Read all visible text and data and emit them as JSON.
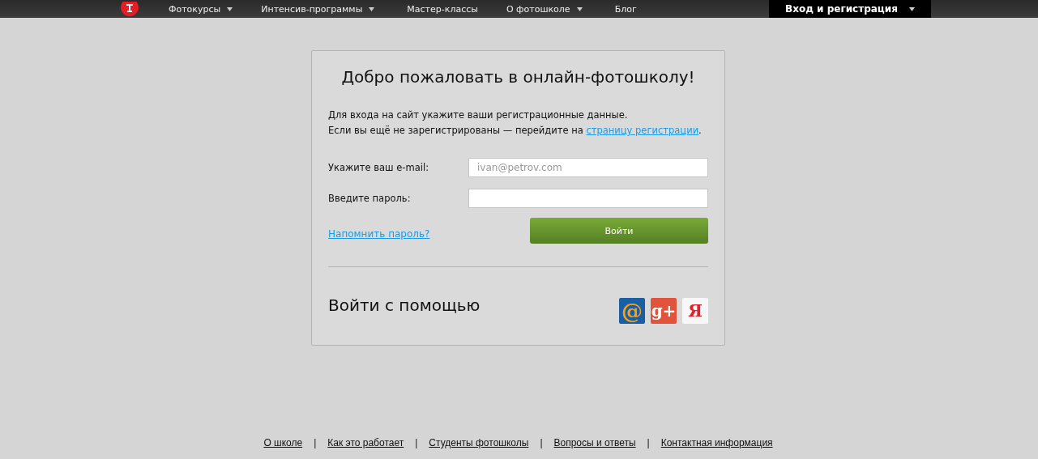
{
  "nav": {
    "items": [
      {
        "label": "Фотокурсы",
        "dropdown": true
      },
      {
        "label": "Интенсив-программы",
        "dropdown": true
      },
      {
        "label": "Мастер-классы",
        "dropdown": false
      },
      {
        "label": "О фотошколе",
        "dropdown": true
      },
      {
        "label": "Блог",
        "dropdown": false
      }
    ],
    "login": {
      "label": "Вход и регистрация",
      "dropdown": true
    }
  },
  "card": {
    "title": "Добро пожаловать в онлайн-фотошколу!",
    "intro_line_1": "Для входа на сайт укажите ваши регистрационные данные.",
    "intro_line_2": "Если вы ещё не зарегистрированы — перейдите на",
    "register_link": "страницу регистрации",
    "intro_end": ".",
    "email_label": "Укажите ваш e-mail:",
    "email_placeholder": "ivan@petrov.com",
    "password_label": "Введите пароль:",
    "forgot_link": "Напомнить пароль?",
    "submit": "Войти",
    "social_title": "Войти с помощью",
    "social": [
      {
        "kind": "mail",
        "label": "@"
      },
      {
        "kind": "google",
        "label": "g+"
      },
      {
        "kind": "yandex",
        "label": "Я"
      }
    ]
  },
  "footer": {
    "links": [
      "О школе",
      "Как это работает",
      "Студенты фотошколы",
      "Вопросы и ответы",
      "Контактная информация"
    ],
    "separator": "|"
  }
}
